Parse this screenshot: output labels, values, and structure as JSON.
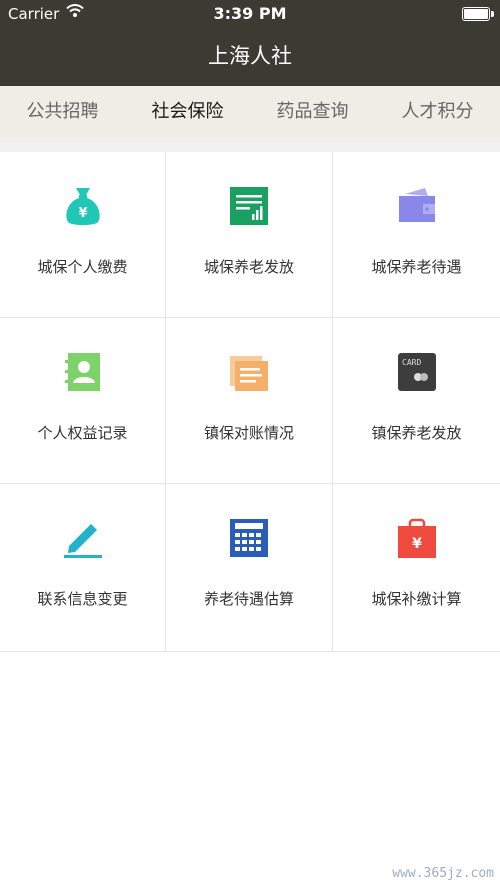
{
  "status_bar": {
    "carrier": "Carrier",
    "time": "3:39 PM"
  },
  "header": {
    "title": "上海人社"
  },
  "tabs": [
    {
      "label": "公共招聘"
    },
    {
      "label": "社会保险",
      "active": true
    },
    {
      "label": "药品查询"
    },
    {
      "label": "人才积分"
    }
  ],
  "grid": [
    {
      "label": "城保个人缴费",
      "icon": "money-bag-icon",
      "color": "#1fc7b6"
    },
    {
      "label": "城保养老发放",
      "icon": "chart-sheet-icon",
      "color": "#1aa060"
    },
    {
      "label": "城保养老待遇",
      "icon": "wallet-icon",
      "color": "#8a87ea"
    },
    {
      "label": "个人权益记录",
      "icon": "contact-book-icon",
      "color": "#7dd26a"
    },
    {
      "label": "镇保对账情况",
      "icon": "documents-icon",
      "color": "#f4b06a"
    },
    {
      "label": "镇保养老发放",
      "icon": "card-icon",
      "color": "#3d3d3d"
    },
    {
      "label": "联系信息变更",
      "icon": "edit-pencil-icon",
      "color": "#22b3c8"
    },
    {
      "label": "养老待遇估算",
      "icon": "calculator-icon",
      "color": "#2a5db8"
    },
    {
      "label": "城保补缴计算",
      "icon": "shopping-bag-icon",
      "color": "#ef4a3e"
    }
  ],
  "watermark": "www.365jz.com"
}
